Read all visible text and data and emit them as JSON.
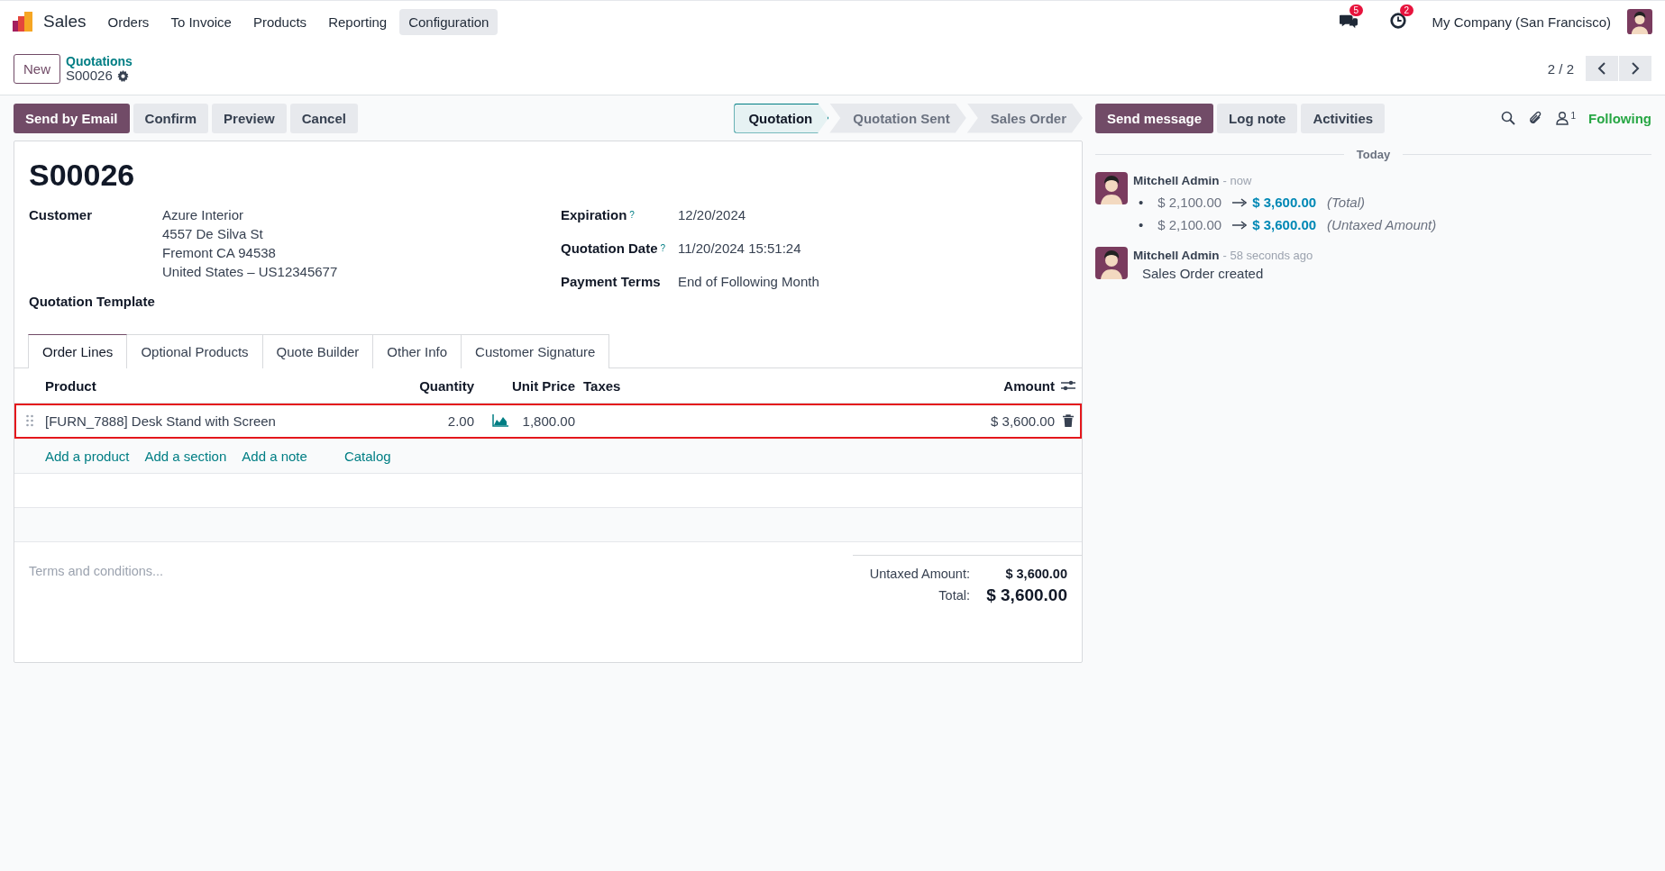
{
  "navbar": {
    "app": "Sales",
    "menu": [
      {
        "label": "Orders",
        "selected": false
      },
      {
        "label": "To Invoice",
        "selected": false
      },
      {
        "label": "Products",
        "selected": false
      },
      {
        "label": "Reporting",
        "selected": false
      },
      {
        "label": "Configuration",
        "selected": true
      }
    ],
    "messages_badge": "5",
    "activities_badge": "2",
    "company": "My Company (San Francisco)"
  },
  "control_panel": {
    "new_button": "New",
    "breadcrumb": "Quotations",
    "record": "S00026",
    "pager": "2 / 2"
  },
  "actions": [
    {
      "label": "Send by Email",
      "kind": "primary"
    },
    {
      "label": "Confirm",
      "kind": "secondary"
    },
    {
      "label": "Preview",
      "kind": "secondary"
    },
    {
      "label": "Cancel",
      "kind": "secondary"
    }
  ],
  "statusbar": [
    {
      "label": "Quotation",
      "selected": true
    },
    {
      "label": "Quotation Sent",
      "selected": false
    },
    {
      "label": "Sales Order",
      "selected": false
    }
  ],
  "form": {
    "title": "S00026",
    "left_fields": [
      {
        "label": "Customer",
        "lines": [
          "Azure Interior",
          "4557 De Silva St",
          "Fremont CA 94538",
          "United States – US12345677"
        ]
      },
      {
        "label": "Quotation Template"
      }
    ],
    "right_fields": [
      {
        "label": "Expiration",
        "help": "?",
        "value": "12/20/2024"
      },
      {
        "label": "Quotation Date",
        "help": "?",
        "value": "11/20/2024 15:51:24"
      },
      {
        "label": "Payment Terms",
        "value": "End of Following Month"
      }
    ],
    "tabs": [
      {
        "label": "Order Lines",
        "selected": true
      },
      {
        "label": "Optional Products",
        "selected": false
      },
      {
        "label": "Quote Builder",
        "selected": false
      },
      {
        "label": "Other Info",
        "selected": false
      },
      {
        "label": "Customer Signature",
        "selected": false
      }
    ],
    "table": {
      "columns": [
        "Product",
        "Quantity",
        "Unit Price",
        "Taxes",
        "Amount"
      ],
      "rows": [
        {
          "product": "[FURN_7888] Desk Stand with Screen",
          "quantity": "2.00",
          "unit_price": "1,800.00",
          "amount": "$ 3,600.00",
          "highlighted": true
        }
      ],
      "add_links": [
        "Add a product",
        "Add a section",
        "Add a note",
        "Catalog"
      ]
    },
    "terms": {
      "placeholder": "Terms and conditions..."
    },
    "totals": [
      {
        "label": "Untaxed Amount:",
        "value": "$ 3,600.00",
        "kind": "subtotal"
      },
      {
        "label": "Total:",
        "value": "$ 3,600.00",
        "kind": "total"
      }
    ]
  },
  "chatter": {
    "buttons": [
      {
        "label": "Send message",
        "kind": "primary"
      },
      {
        "label": "Log note",
        "kind": "secondary"
      },
      {
        "label": "Activities",
        "kind": "secondary"
      }
    ],
    "followers_count": "1",
    "follow_label": "Following",
    "date_separator": "Today",
    "messages": [
      {
        "author": "Mitchell Admin",
        "time": "- now",
        "changes": [
          {
            "bullet": "•",
            "old": "$ 2,100.00",
            "new": "$ 3,600.00",
            "field": "(Total)"
          },
          {
            "bullet": "•",
            "old": "$ 2,100.00",
            "new": "$ 3,600.00",
            "field": "(Untaxed Amount)"
          }
        ]
      },
      {
        "author": "Mitchell Admin",
        "time": "- 58 seconds ago",
        "body": "Sales Order created"
      }
    ]
  }
}
